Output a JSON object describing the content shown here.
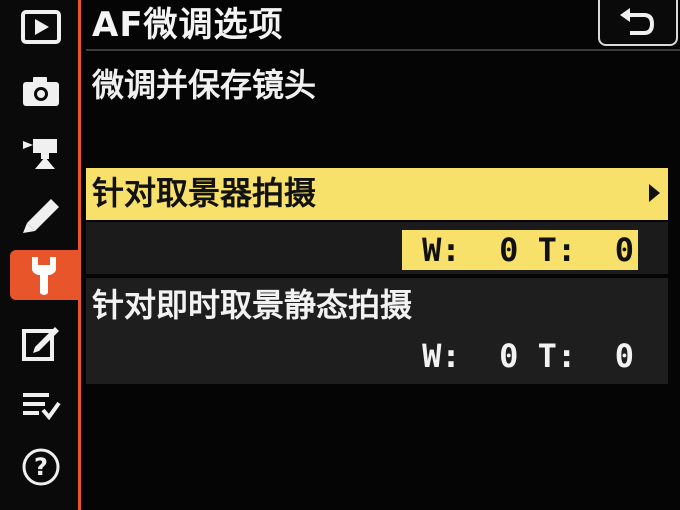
{
  "header": {
    "title": "AF微调选项",
    "back_icon": "return-arrow-icon"
  },
  "subtitle": "微调并保存镜头",
  "options": [
    {
      "label": "针对取景器拍摄",
      "value": "W:  0 T:  0",
      "selected": true
    },
    {
      "label": "针对即时取景静态拍摄",
      "value": "W:  0 T:  0",
      "selected": false
    }
  ],
  "sidebar": {
    "items": [
      {
        "icon": "playback-icon",
        "active": false
      },
      {
        "icon": "camera-icon",
        "active": false
      },
      {
        "icon": "movie-camera-icon",
        "active": false
      },
      {
        "icon": "pencil-icon",
        "active": false
      },
      {
        "icon": "wrench-icon",
        "active": true
      },
      {
        "icon": "retouch-icon",
        "active": false
      },
      {
        "icon": "my-menu-icon",
        "active": false
      },
      {
        "icon": "help-icon",
        "active": false
      }
    ]
  },
  "colors": {
    "accent": "#e8552a",
    "highlight": "#f8e16b",
    "background": "#050505",
    "text": "#f2f2f2"
  }
}
